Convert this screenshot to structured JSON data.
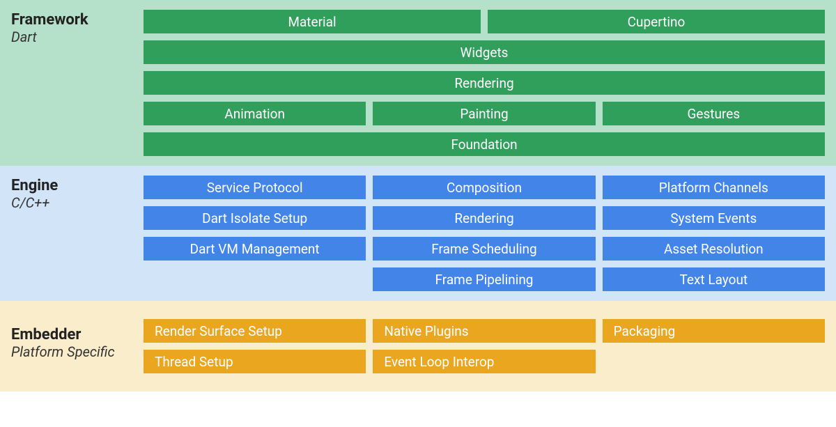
{
  "framework": {
    "title": "Framework",
    "subtitle": "Dart",
    "row1": [
      "Material",
      "Cupertino"
    ],
    "row2": "Widgets",
    "row3": "Rendering",
    "row4": [
      "Animation",
      "Painting",
      "Gestures"
    ],
    "row5": "Foundation"
  },
  "engine": {
    "title": "Engine",
    "subtitle": "C/C++",
    "col1": [
      "Service Protocol",
      "Dart Isolate Setup",
      "Dart VM Management"
    ],
    "col2": [
      "Composition",
      "Rendering",
      "Frame Scheduling",
      "Frame Pipelining"
    ],
    "col3": [
      "Platform Channels",
      "System Events",
      "Asset Resolution",
      "Text Layout"
    ]
  },
  "embedder": {
    "title": "Embedder",
    "subtitle": "Platform Specific",
    "col1": [
      "Render Surface Setup",
      "Thread Setup"
    ],
    "col2": [
      "Native Plugins",
      "Event Loop Interop"
    ],
    "col3": [
      "Packaging"
    ]
  }
}
